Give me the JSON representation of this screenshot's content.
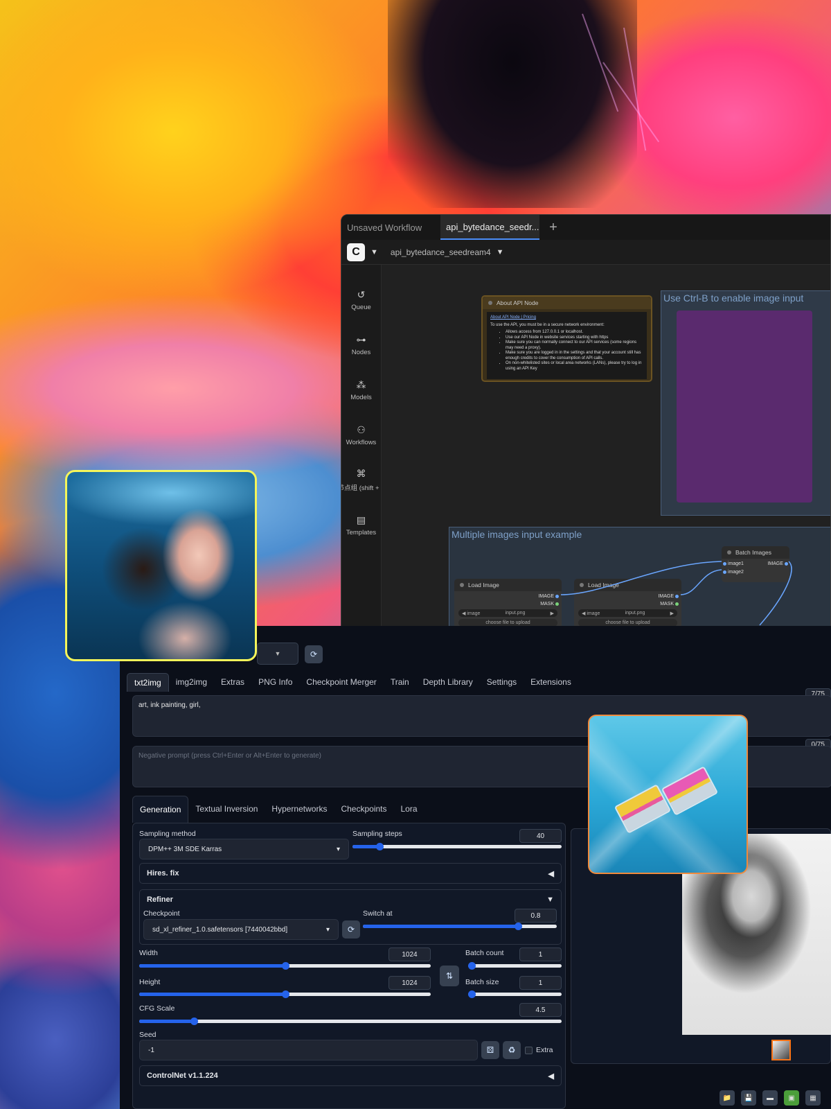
{
  "comfy": {
    "tabs": [
      "Unsaved Workflow",
      "api_bytedance_seedr..."
    ],
    "add_tab": "+",
    "workflow_name": "api_bytedance_seedream4",
    "sidebar": [
      {
        "label": "Queue",
        "icon": "↺"
      },
      {
        "label": "Nodes",
        "icon": "⊶"
      },
      {
        "label": "Models",
        "icon": "⁂"
      },
      {
        "label": "Workflows",
        "icon": "⚇"
      },
      {
        "label": "节点组 (shift + n",
        "icon": "⌘"
      },
      {
        "label": "Templates",
        "icon": "▤"
      }
    ],
    "about_node": {
      "title": "About API Node",
      "links": "About API Node | Pricing",
      "intro": "To use the API, you must be in a secure network environment:",
      "bullets": [
        "Allows access from 127.0.0.1 or localhost.",
        "Use our API Node in website services starting with https",
        "Make sure you can normally connect to our API services (some regions may need a proxy).",
        "Make sure you are logged in in the settings and that your account still has enough credits to cover the consumption of API calls.",
        "On non-whitelisted sites or local area networks (LANs), please try to log in using an API Key"
      ]
    },
    "group1_title": "Use Ctrl-B to enable image input",
    "group2_title": "Multiple images input example",
    "batch_node": {
      "title": "Batch Images",
      "in1": "image1",
      "in2": "image2",
      "out": "IMAGE"
    },
    "load_nodes": [
      {
        "title": "Load Image",
        "out1": "IMAGE",
        "out2": "MASK",
        "widget_label": "image",
        "widget_value": "input.png",
        "upload": "choose file to upload"
      },
      {
        "title": "Load Image",
        "out1": "IMAGE",
        "out2": "MASK",
        "widget_label": "image",
        "widget_value": "input.png",
        "upload": "choose file to upload"
      }
    ]
  },
  "sd": {
    "tabs": [
      "txt2img",
      "img2img",
      "Extras",
      "PNG Info",
      "Checkpoint Merger",
      "Train",
      "Depth Library",
      "Settings",
      "Extensions"
    ],
    "prompt": "art, ink painting, girl,",
    "prompt_count": "7/75",
    "negative_placeholder": "Negative prompt (press Ctrl+Enter or Alt+Enter to generate)",
    "negative_count": "0/75",
    "gen_tabs": [
      "Generation",
      "Textual Inversion",
      "Hypernetworks",
      "Checkpoints",
      "Lora"
    ],
    "sampling_method_label": "Sampling method",
    "sampling_method": "DPM++ 3M SDE Karras",
    "sampling_steps_label": "Sampling steps",
    "sampling_steps": "40",
    "hires_label": "Hires. fix",
    "refiner_label": "Refiner",
    "checkpoint_label": "Checkpoint",
    "checkpoint": "sd_xl_refiner_1.0.safetensors [7440042bbd]",
    "switch_label": "Switch at",
    "switch_value": "0.8",
    "width_label": "Width",
    "width": "1024",
    "height_label": "Height",
    "height": "1024",
    "batch_count_label": "Batch count",
    "batch_count": "1",
    "batch_size_label": "Batch size",
    "batch_size": "1",
    "cfg_label": "CFG Scale",
    "cfg": "4.5",
    "seed_label": "Seed",
    "seed": "-1",
    "extra_label": "Extra",
    "controlnet_label": "ControlNet v1.1.224",
    "slider_levels": {
      "sampling_steps": 0.13,
      "switch_at": 0.8,
      "width": 0.5,
      "height": 0.5,
      "batch_count": 0.0,
      "batch_size": 0.0,
      "cfg": 0.13
    }
  }
}
